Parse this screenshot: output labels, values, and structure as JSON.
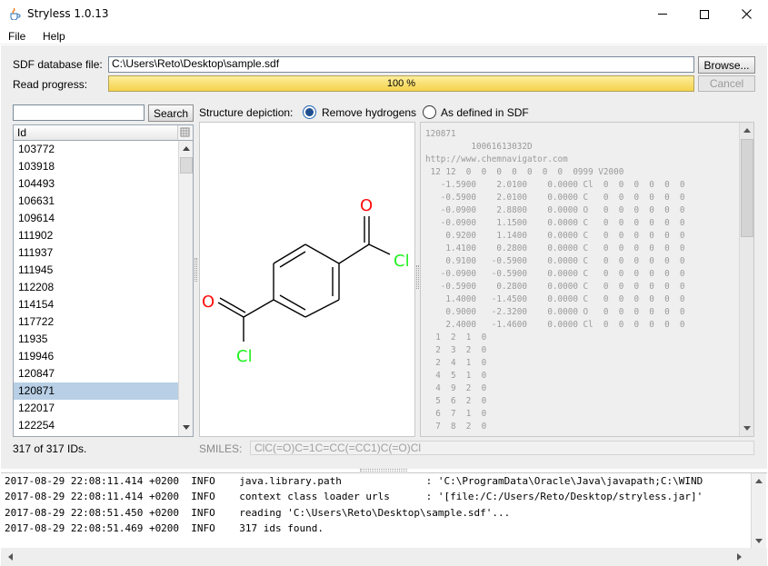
{
  "window": {
    "title": "Stryless 1.0.13",
    "controls": {
      "minimize": "minimize-icon",
      "maximize": "maximize-icon",
      "close": "close-icon"
    }
  },
  "menu": [
    {
      "label": "File"
    },
    {
      "label": "Help"
    }
  ],
  "sdf": {
    "label": "SDF database file:",
    "value": "C:\\Users\\Reto\\Desktop\\sample.sdf",
    "browse_label": "Browse...",
    "progress_label": "Read progress:",
    "progress_text": "100 %",
    "progress_value": 100,
    "cancel_label": "Cancel"
  },
  "search": {
    "value": "",
    "button_label": "Search"
  },
  "depiction_options": {
    "label": "Structure depiction:",
    "options": [
      {
        "label": "Remove hydrogens",
        "selected": true
      },
      {
        "label": "As defined in SDF",
        "selected": false
      }
    ]
  },
  "id_list": {
    "header": "Id",
    "items": [
      "103772",
      "103918",
      "104493",
      "106631",
      "109614",
      "111902",
      "111937",
      "111945",
      "112208",
      "114154",
      "117722",
      "11935",
      "119946",
      "120847",
      "120871",
      "122017",
      "122254"
    ],
    "selected": "120871",
    "count_text": "317 of 317 IDs."
  },
  "molecule": {
    "atom_labels": {
      "o_top": "O",
      "cl_right": "Cl",
      "o_left": "O",
      "cl_bottom": "Cl"
    },
    "colors": {
      "oxygen": "#ff0d0d",
      "chlorine": "#1ff01f",
      "bond": "#000000"
    }
  },
  "molfile": {
    "lines": [
      "120871",
      "         10061613032D",
      "http://www.chemnavigator.com",
      " 12 12  0  0  0  0  0  0  0  0999 V2000",
      "   -1.5900    2.0100    0.0000 Cl  0  0  0  0  0  0",
      "   -0.5900    2.0100    0.0000 C   0  0  0  0  0  0",
      "   -0.0900    2.8800    0.0000 O   0  0  0  0  0  0",
      "   -0.0900    1.1500    0.0000 C   0  0  0  0  0  0",
      "    0.9200    1.1400    0.0000 C   0  0  0  0  0  0",
      "    1.4100    0.2800    0.0000 C   0  0  0  0  0  0",
      "    0.9100   -0.5900    0.0000 C   0  0  0  0  0  0",
      "   -0.0900   -0.5900    0.0000 C   0  0  0  0  0  0",
      "   -0.5900    0.2800    0.0000 C   0  0  0  0  0  0",
      "    1.4000   -1.4500    0.0000 C   0  0  0  0  0  0",
      "    0.9000   -2.3200    0.0000 O   0  0  0  0  0  0",
      "    2.4000   -1.4600    0.0000 Cl  0  0  0  0  0  0",
      "  1  2  1  0",
      "  2  3  2  0",
      "  2  4  1  0",
      "  4  5  1  0",
      "  4  9  2  0",
      "  5  6  2  0",
      "  6  7  1  0",
      "  7  8  2  0"
    ]
  },
  "smiles": {
    "label": "SMILES:",
    "value": "ClC(=O)C=1C=CC(=CC1)C(=O)Cl"
  },
  "log": {
    "lines": [
      "2017-08-29 22:08:11.414 +0200  INFO    java.library.path              : 'C:\\ProgramData\\Oracle\\Java\\javapath;C:\\WIND",
      "2017-08-29 22:08:11.414 +0200  INFO    context class loader urls      : '[file:/C:/Users/Reto/Desktop/stryless.jar]'",
      "2017-08-29 22:08:51.450 +0200  INFO    reading 'C:\\Users\\Reto\\Desktop\\sample.sdf'...",
      "2017-08-29 22:08:51.469 +0200  INFO    317 ids found."
    ]
  }
}
